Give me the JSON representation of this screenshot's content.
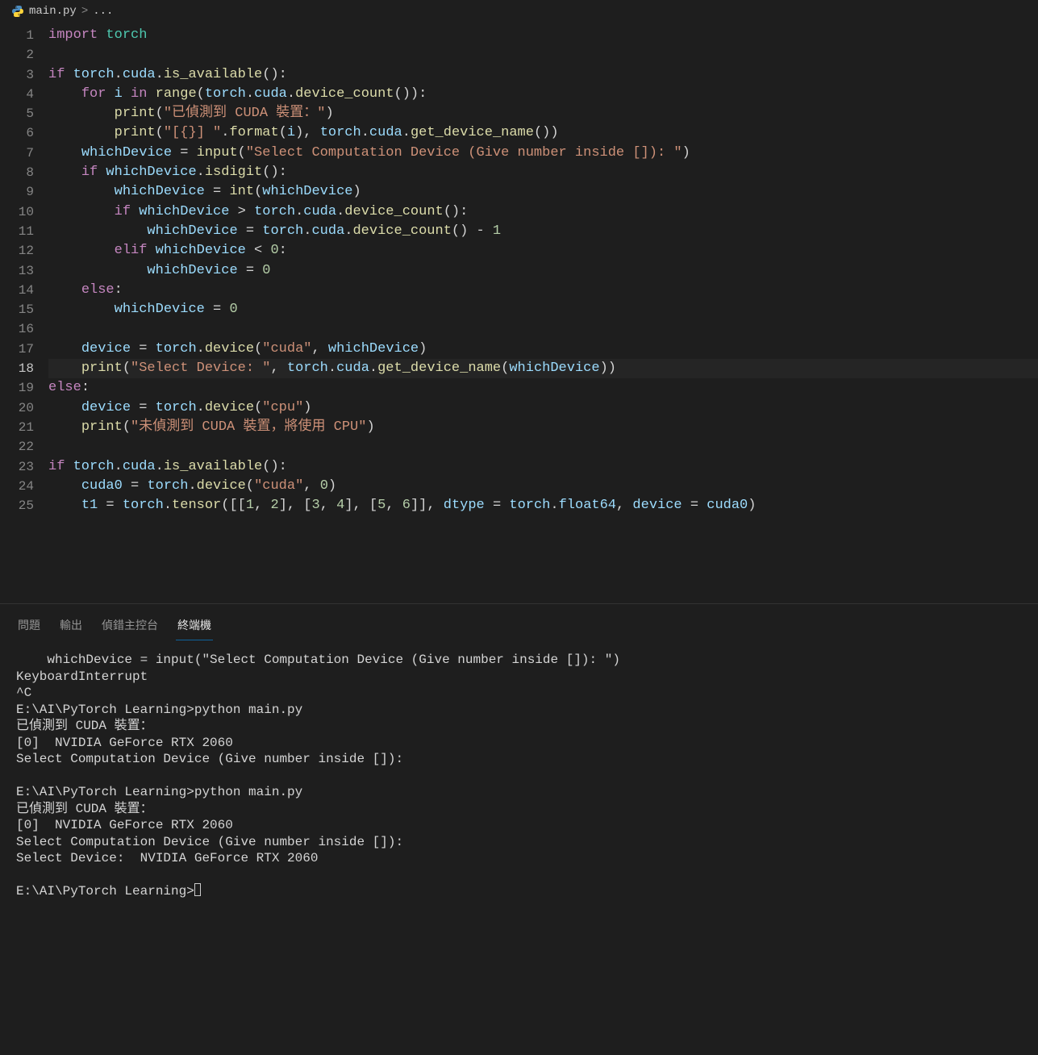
{
  "breadcrumb": {
    "file_icon": "python-icon",
    "file": "main.py",
    "separator": ">",
    "symbol": "..."
  },
  "editor": {
    "current_line": 18,
    "lines": [
      {
        "n": 1,
        "tokens": [
          [
            "k",
            "import"
          ],
          [
            "p",
            " "
          ],
          [
            "cls",
            "torch"
          ]
        ]
      },
      {
        "n": 2,
        "tokens": []
      },
      {
        "n": 3,
        "tokens": [
          [
            "k",
            "if"
          ],
          [
            "p",
            " "
          ],
          [
            "id",
            "torch"
          ],
          [
            "p",
            "."
          ],
          [
            "id",
            "cuda"
          ],
          [
            "p",
            "."
          ],
          [
            "fn",
            "is_available"
          ],
          [
            "p",
            "():"
          ]
        ]
      },
      {
        "n": 4,
        "tokens": [
          [
            "p",
            "    "
          ],
          [
            "k",
            "for"
          ],
          [
            "p",
            " "
          ],
          [
            "id",
            "i"
          ],
          [
            "p",
            " "
          ],
          [
            "k",
            "in"
          ],
          [
            "p",
            " "
          ],
          [
            "fn",
            "range"
          ],
          [
            "p",
            "("
          ],
          [
            "id",
            "torch"
          ],
          [
            "p",
            "."
          ],
          [
            "id",
            "cuda"
          ],
          [
            "p",
            "."
          ],
          [
            "fn",
            "device_count"
          ],
          [
            "p",
            "()):"
          ]
        ]
      },
      {
        "n": 5,
        "tokens": [
          [
            "p",
            "        "
          ],
          [
            "fn",
            "print"
          ],
          [
            "p",
            "("
          ],
          [
            "s",
            "\"已偵測到 CUDA 裝置：\""
          ],
          [
            "p",
            ")"
          ]
        ]
      },
      {
        "n": 6,
        "tokens": [
          [
            "p",
            "        "
          ],
          [
            "fn",
            "print"
          ],
          [
            "p",
            "("
          ],
          [
            "s",
            "\"[{}] \""
          ],
          [
            "p",
            "."
          ],
          [
            "fn",
            "format"
          ],
          [
            "p",
            "("
          ],
          [
            "id",
            "i"
          ],
          [
            "p",
            "), "
          ],
          [
            "id",
            "torch"
          ],
          [
            "p",
            "."
          ],
          [
            "id",
            "cuda"
          ],
          [
            "p",
            "."
          ],
          [
            "fn",
            "get_device_name"
          ],
          [
            "p",
            "())"
          ]
        ]
      },
      {
        "n": 7,
        "tokens": [
          [
            "p",
            "    "
          ],
          [
            "id",
            "whichDevice"
          ],
          [
            "p",
            " = "
          ],
          [
            "fn",
            "input"
          ],
          [
            "p",
            "("
          ],
          [
            "s",
            "\"Select Computation Device (Give number inside []): \""
          ],
          [
            "p",
            ")"
          ]
        ]
      },
      {
        "n": 8,
        "tokens": [
          [
            "p",
            "    "
          ],
          [
            "k",
            "if"
          ],
          [
            "p",
            " "
          ],
          [
            "id",
            "whichDevice"
          ],
          [
            "p",
            "."
          ],
          [
            "fn",
            "isdigit"
          ],
          [
            "p",
            "():"
          ]
        ]
      },
      {
        "n": 9,
        "tokens": [
          [
            "p",
            "        "
          ],
          [
            "id",
            "whichDevice"
          ],
          [
            "p",
            " = "
          ],
          [
            "fn",
            "int"
          ],
          [
            "p",
            "("
          ],
          [
            "id",
            "whichDevice"
          ],
          [
            "p",
            ")"
          ]
        ]
      },
      {
        "n": 10,
        "tokens": [
          [
            "p",
            "        "
          ],
          [
            "k",
            "if"
          ],
          [
            "p",
            " "
          ],
          [
            "id",
            "whichDevice"
          ],
          [
            "p",
            " > "
          ],
          [
            "id",
            "torch"
          ],
          [
            "p",
            "."
          ],
          [
            "id",
            "cuda"
          ],
          [
            "p",
            "."
          ],
          [
            "fn",
            "device_count"
          ],
          [
            "p",
            "():"
          ]
        ]
      },
      {
        "n": 11,
        "tokens": [
          [
            "p",
            "            "
          ],
          [
            "id",
            "whichDevice"
          ],
          [
            "p",
            " = "
          ],
          [
            "id",
            "torch"
          ],
          [
            "p",
            "."
          ],
          [
            "id",
            "cuda"
          ],
          [
            "p",
            "."
          ],
          [
            "fn",
            "device_count"
          ],
          [
            "p",
            "() - "
          ],
          [
            "n",
            "1"
          ]
        ]
      },
      {
        "n": 12,
        "tokens": [
          [
            "p",
            "        "
          ],
          [
            "k",
            "elif"
          ],
          [
            "p",
            " "
          ],
          [
            "id",
            "whichDevice"
          ],
          [
            "p",
            " < "
          ],
          [
            "n",
            "0"
          ],
          [
            "p",
            ":"
          ]
        ]
      },
      {
        "n": 13,
        "tokens": [
          [
            "p",
            "            "
          ],
          [
            "id",
            "whichDevice"
          ],
          [
            "p",
            " = "
          ],
          [
            "n",
            "0"
          ]
        ]
      },
      {
        "n": 14,
        "tokens": [
          [
            "p",
            "    "
          ],
          [
            "k",
            "else"
          ],
          [
            "p",
            ":"
          ]
        ]
      },
      {
        "n": 15,
        "tokens": [
          [
            "p",
            "        "
          ],
          [
            "id",
            "whichDevice"
          ],
          [
            "p",
            " = "
          ],
          [
            "n",
            "0"
          ]
        ]
      },
      {
        "n": 16,
        "tokens": []
      },
      {
        "n": 17,
        "tokens": [
          [
            "p",
            "    "
          ],
          [
            "id",
            "device"
          ],
          [
            "p",
            " = "
          ],
          [
            "id",
            "torch"
          ],
          [
            "p",
            "."
          ],
          [
            "fn",
            "device"
          ],
          [
            "p",
            "("
          ],
          [
            "s",
            "\"cuda\""
          ],
          [
            "p",
            ", "
          ],
          [
            "id",
            "whichDevice"
          ],
          [
            "p",
            ")"
          ]
        ]
      },
      {
        "n": 18,
        "tokens": [
          [
            "p",
            "    "
          ],
          [
            "fn",
            "print"
          ],
          [
            "p",
            "("
          ],
          [
            "s",
            "\"Select Device: \""
          ],
          [
            "p",
            ", "
          ],
          [
            "id",
            "torch"
          ],
          [
            "p",
            "."
          ],
          [
            "id",
            "cuda"
          ],
          [
            "p",
            "."
          ],
          [
            "fn",
            "get_device_name"
          ],
          [
            "p",
            "("
          ],
          [
            "id",
            "whichDevice"
          ],
          [
            "p",
            "))"
          ]
        ]
      },
      {
        "n": 19,
        "tokens": [
          [
            "k",
            "else"
          ],
          [
            "p",
            ":"
          ]
        ]
      },
      {
        "n": 20,
        "tokens": [
          [
            "p",
            "    "
          ],
          [
            "id",
            "device"
          ],
          [
            "p",
            " = "
          ],
          [
            "id",
            "torch"
          ],
          [
            "p",
            "."
          ],
          [
            "fn",
            "device"
          ],
          [
            "p",
            "("
          ],
          [
            "s",
            "\"cpu\""
          ],
          [
            "p",
            ")"
          ]
        ]
      },
      {
        "n": 21,
        "tokens": [
          [
            "p",
            "    "
          ],
          [
            "fn",
            "print"
          ],
          [
            "p",
            "("
          ],
          [
            "s",
            "\"未偵測到 CUDA 裝置，將使用 CPU\""
          ],
          [
            "p",
            ")"
          ]
        ]
      },
      {
        "n": 22,
        "tokens": []
      },
      {
        "n": 23,
        "tokens": [
          [
            "k",
            "if"
          ],
          [
            "p",
            " "
          ],
          [
            "id",
            "torch"
          ],
          [
            "p",
            "."
          ],
          [
            "id",
            "cuda"
          ],
          [
            "p",
            "."
          ],
          [
            "fn",
            "is_available"
          ],
          [
            "p",
            "():"
          ]
        ]
      },
      {
        "n": 24,
        "tokens": [
          [
            "p",
            "    "
          ],
          [
            "id",
            "cuda0"
          ],
          [
            "p",
            " = "
          ],
          [
            "id",
            "torch"
          ],
          [
            "p",
            "."
          ],
          [
            "fn",
            "device"
          ],
          [
            "p",
            "("
          ],
          [
            "s",
            "\"cuda\""
          ],
          [
            "p",
            ", "
          ],
          [
            "n",
            "0"
          ],
          [
            "p",
            ")"
          ]
        ]
      },
      {
        "n": 25,
        "tokens": [
          [
            "p",
            "    "
          ],
          [
            "id",
            "t1"
          ],
          [
            "p",
            " = "
          ],
          [
            "id",
            "torch"
          ],
          [
            "p",
            "."
          ],
          [
            "fn",
            "tensor"
          ],
          [
            "p",
            "([["
          ],
          [
            "n",
            "1"
          ],
          [
            "p",
            ", "
          ],
          [
            "n",
            "2"
          ],
          [
            "p",
            "], ["
          ],
          [
            "n",
            "3"
          ],
          [
            "p",
            ", "
          ],
          [
            "n",
            "4"
          ],
          [
            "p",
            "], ["
          ],
          [
            "n",
            "5"
          ],
          [
            "p",
            ", "
          ],
          [
            "n",
            "6"
          ],
          [
            "p",
            "]], "
          ],
          [
            "id",
            "dtype"
          ],
          [
            "p",
            " = "
          ],
          [
            "id",
            "torch"
          ],
          [
            "p",
            "."
          ],
          [
            "id",
            "float64"
          ],
          [
            "p",
            ", "
          ],
          [
            "id",
            "device"
          ],
          [
            "p",
            " = "
          ],
          [
            "id",
            "cuda0"
          ],
          [
            "p",
            ")"
          ]
        ]
      }
    ]
  },
  "panel": {
    "tabs": [
      {
        "id": "problems",
        "label": "問題",
        "active": false
      },
      {
        "id": "output",
        "label": "輸出",
        "active": false
      },
      {
        "id": "debug",
        "label": "偵錯主控台",
        "active": false
      },
      {
        "id": "terminal",
        "label": "終端機",
        "active": true
      }
    ],
    "terminal_lines": [
      "    whichDevice = input(\"Select Computation Device (Give number inside []): \")",
      "KeyboardInterrupt",
      "^C",
      "E:\\AI\\PyTorch Learning>python main.py",
      "已偵測到 CUDA 裝置：",
      "[0]  NVIDIA GeForce RTX 2060",
      "Select Computation Device (Give number inside []):",
      "",
      "E:\\AI\\PyTorch Learning>python main.py",
      "已偵測到 CUDA 裝置：",
      "[0]  NVIDIA GeForce RTX 2060",
      "Select Computation Device (Give number inside []):",
      "Select Device:  NVIDIA GeForce RTX 2060",
      "",
      "E:\\AI\\PyTorch Learning>"
    ]
  }
}
